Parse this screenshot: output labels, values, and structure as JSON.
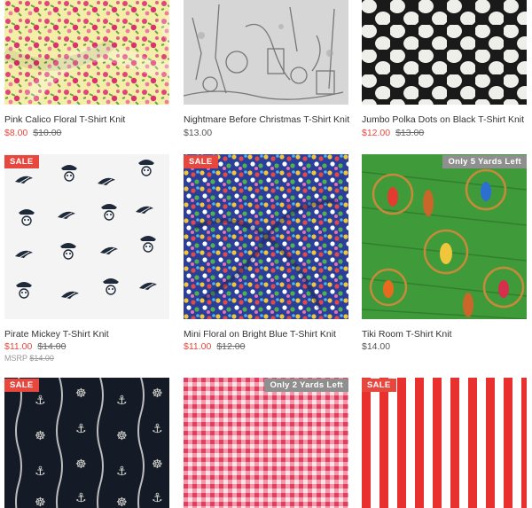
{
  "products": [
    {
      "title": "Pink Calico Floral T-Shirt Knit",
      "price": "$8.00",
      "was": "$10.00",
      "badge": "",
      "stock": "",
      "msrp_label": "",
      "msrp": "",
      "image": "pink-calico-floral-swatch"
    },
    {
      "title": "Nightmare Before Christmas T-Shirt Knit",
      "price": "$13.00",
      "was": "",
      "badge": "",
      "stock": "",
      "msrp_label": "",
      "msrp": "",
      "image": "nightmare-before-christmas-swatch"
    },
    {
      "title": "Jumbo Polka Dots on Black T-Shirt Knit",
      "price": "$12.00",
      "was": "$13.00",
      "badge": "",
      "stock": "",
      "msrp_label": "",
      "msrp": "",
      "image": "jumbo-polka-dots-swatch"
    },
    {
      "title": "Pirate Mickey T-Shirt Knit",
      "price": "$11.00",
      "was": "$14.00",
      "badge": "SALE",
      "stock": "",
      "msrp_label": "MSRP",
      "msrp": "$14.00",
      "image": "pirate-mickey-swatch"
    },
    {
      "title": "Mini Floral on Bright Blue T-Shirt Knit",
      "price": "$11.00",
      "was": "$12.00",
      "badge": "SALE",
      "stock": "",
      "msrp_label": "",
      "msrp": "",
      "image": "mini-floral-blue-swatch"
    },
    {
      "title": "Tiki Room T-Shirt Knit",
      "price": "$14.00",
      "was": "",
      "badge": "",
      "stock": "Only 5 Yards Left",
      "msrp_label": "",
      "msrp": "",
      "image": "tiki-room-swatch"
    },
    {
      "title": "",
      "price": "",
      "was": "",
      "badge": "SALE",
      "stock": "",
      "msrp_label": "",
      "msrp": "",
      "image": "anchor-navy-swatch"
    },
    {
      "title": "",
      "price": "",
      "was": "",
      "badge": "",
      "stock": "Only 2 Yards Left",
      "msrp_label": "",
      "msrp": "",
      "image": "red-gingham-swatch"
    },
    {
      "title": "",
      "price": "",
      "was": "",
      "badge": "SALE",
      "stock": "",
      "msrp_label": "",
      "msrp": "",
      "image": "red-stripe-swatch"
    }
  ],
  "colors": {
    "sale": "#e8473e",
    "stock_badge": "#8f8f8f",
    "title": "#333333",
    "strike": "#666666"
  }
}
